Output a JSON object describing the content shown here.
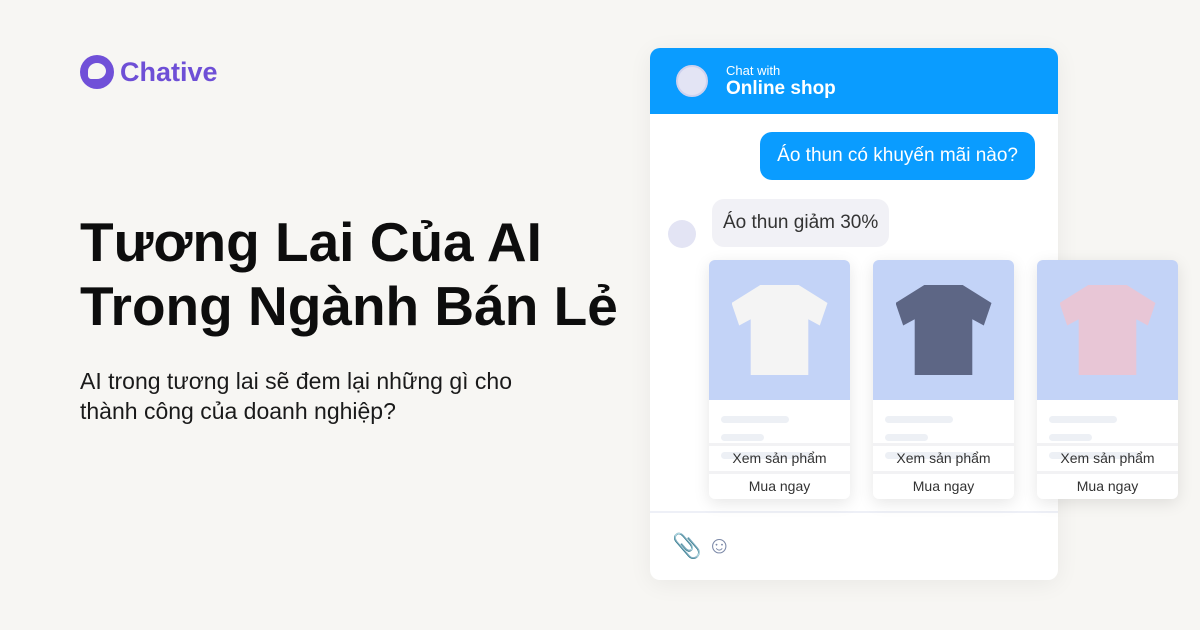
{
  "brand": {
    "name": "Chative"
  },
  "hero": {
    "title_line1": "Tương Lai Của AI",
    "title_line2": "Trong Ngành Bán Lẻ",
    "subtitle_line1": "AI trong tương lai sẽ đem lại những gì cho",
    "subtitle_line2": "thành công của doanh nghiệp?"
  },
  "chat": {
    "header_small": "Chat with",
    "header_title": "Online shop",
    "user_message": "Áo thun có khuyến mãi nào?",
    "bot_message": "Áo thun giảm 30%",
    "accent": "#0a9cff",
    "products": [
      {
        "color": "#f4f4f4",
        "view": "Xem sản phẩm",
        "buy": "Mua ngay"
      },
      {
        "color": "#5d6685",
        "view": "Xem sản phẩm",
        "buy": "Mua ngay"
      },
      {
        "color": "#e8c6d6",
        "view": "Xem sản phẩm",
        "buy": "Mua ngay"
      }
    ],
    "icons": [
      "paperclip-icon",
      "smile-icon"
    ]
  }
}
